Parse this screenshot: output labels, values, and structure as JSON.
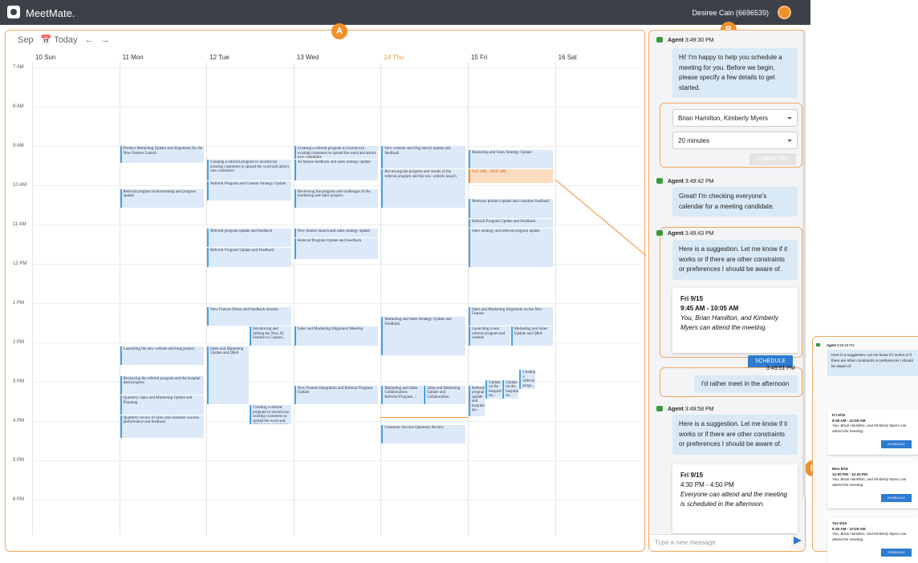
{
  "app": {
    "name": "MeetMate.",
    "user": "Desiree Cain (6696539)"
  },
  "calendar": {
    "month": "Sep",
    "today_label": "Today",
    "days": [
      {
        "label": "10 Sun"
      },
      {
        "label": "11 Mon"
      },
      {
        "label": "12 Tue"
      },
      {
        "label": "13 Wed"
      },
      {
        "label": "14 Thu",
        "today": true
      },
      {
        "label": "15 Fri"
      },
      {
        "label": "16 Sat"
      }
    ],
    "hours": [
      "7 AM",
      "8 AM",
      "9 AM",
      "10 AM",
      "11 AM",
      "12 PM",
      "1 PM",
      "2 PM",
      "3 PM",
      "4 PM",
      "5 PM",
      "6 PM"
    ],
    "events": [
      {
        "day": 1,
        "start": 9.0,
        "end": 9.45,
        "title": "Product Marketing Update and Alignment for the New Feature Launch"
      },
      {
        "day": 1,
        "start": 10.1,
        "end": 10.6,
        "title": "Referral program brainstorming and progress update"
      },
      {
        "day": 1,
        "start": 14.1,
        "end": 14.6,
        "title": "Launching the new website and blog project"
      },
      {
        "day": 1,
        "start": 14.85,
        "end": 15.35,
        "title": "Reviewing the referral program and the hospital deal progress"
      },
      {
        "day": 1,
        "start": 15.35,
        "end": 15.85,
        "title": "Quarterly Sales and Marketing Update and Planning"
      },
      {
        "day": 1,
        "start": 15.85,
        "end": 16.45,
        "title": "Quarterly review of sales and customer success performance and feedback"
      },
      {
        "day": 2,
        "start": 9.35,
        "end": 9.9,
        "title": "Creating a referral program to incentivize existing customers to spread the word and attract new customers"
      },
      {
        "day": 2,
        "start": 9.9,
        "end": 10.4,
        "title": "Referral Program and Content Strategy Update"
      },
      {
        "day": 2,
        "start": 11.1,
        "end": 11.6,
        "title": "Referral program update and feedback"
      },
      {
        "day": 2,
        "start": 11.6,
        "end": 12.1,
        "title": "Referral Program Update and Feedback"
      },
      {
        "day": 2,
        "start": 13.1,
        "end": 13.6,
        "title": "New Feature Demo and Feedback Session"
      },
      {
        "day": 2,
        "start": 13.6,
        "end": 14.1,
        "title": "Introducing and Selling the New AI Feature to Custom...",
        "col": 1,
        "cols": 2
      },
      {
        "day": 2,
        "start": 14.1,
        "end": 15.6,
        "title": "Sales and Marketing Update and Q&A",
        "col": 0,
        "cols": 2
      },
      {
        "day": 2,
        "start": 15.6,
        "end": 16.1,
        "title": "Creating a referral program to incentivize existing customers to spread the word and attract new customers",
        "col": 1,
        "cols": 2
      },
      {
        "day": 3,
        "start": 9.0,
        "end": 9.35,
        "title": "Creating a referral program to incentivize existing customers to spread the word and attract new customers"
      },
      {
        "day": 3,
        "start": 9.35,
        "end": 9.9,
        "title": "AI feature feedback and sales strategy update"
      },
      {
        "day": 3,
        "start": 10.1,
        "end": 10.6,
        "title": "Reviewing the progress and challenges of the marketing and sales projects"
      },
      {
        "day": 3,
        "start": 11.1,
        "end": 11.35,
        "title": "New feature launch and sales strategy update"
      },
      {
        "day": 3,
        "start": 11.35,
        "end": 11.9,
        "title": "Referral Program Update and Feedback"
      },
      {
        "day": 3,
        "start": 13.6,
        "end": 14.1,
        "title": "Sales and Marketing Alignment Meeting"
      },
      {
        "day": 3,
        "start": 15.1,
        "end": 15.6,
        "title": "New Feature Integration and Referral Program Update"
      },
      {
        "day": 4,
        "start": 9.0,
        "end": 9.6,
        "title": "New website and blog launch update and feedback"
      },
      {
        "day": 4,
        "start": 9.6,
        "end": 10.6,
        "title": "Reviewing the progress and results of the referral program and the new website launch"
      },
      {
        "day": 4,
        "start": 13.35,
        "end": 14.35,
        "title": "Marketing and Sales Strategy Update and Feedback"
      },
      {
        "day": 4,
        "start": 15.1,
        "end": 15.6,
        "title": "Marketing and Sales Collaboration: Referral Program ...",
        "col": 0,
        "cols": 2
      },
      {
        "day": 4,
        "start": 15.1,
        "end": 15.6,
        "title": "Sales and Marketing Update and Collaboration",
        "col": 1,
        "cols": 2
      },
      {
        "day": 4,
        "start": 16.1,
        "end": 16.6,
        "title": "Customer Success Quarterly Review"
      },
      {
        "day": 5,
        "start": 9.1,
        "end": 9.6,
        "title": "Marketing and Sales Strategy Update"
      },
      {
        "day": 5,
        "start": 9.6,
        "end": 9.95,
        "title": "9:45 AM - 10:05 AM",
        "orange": true
      },
      {
        "day": 5,
        "start": 10.35,
        "end": 10.85,
        "title": "Medwise product update and customer feedback"
      },
      {
        "day": 5,
        "start": 10.85,
        "end": 11.1,
        "title": "Referral Program Update and Feedback"
      },
      {
        "day": 5,
        "start": 11.1,
        "end": 12.1,
        "title": "Sales strategy and referral program update"
      },
      {
        "day": 5,
        "start": 13.1,
        "end": 13.6,
        "title": "Sales and Marketing Alignment on the New Feature"
      },
      {
        "day": 5,
        "start": 13.6,
        "end": 14.1,
        "title": "Launching a new referral program and website",
        "col": 0,
        "cols": 2
      },
      {
        "day": 5,
        "start": 13.6,
        "end": 14.1,
        "title": "Marketing and Sales Update and Q&A",
        "col": 1,
        "cols": 2
      },
      {
        "day": 5,
        "start": 15.1,
        "end": 15.9,
        "title": "Referral program update and hospital pa...",
        "col": 0,
        "cols": 5
      },
      {
        "day": 5,
        "start": 14.95,
        "end": 15.45,
        "title": "Update on the hospital ne...",
        "col": 1,
        "cols": 5
      },
      {
        "day": 5,
        "start": 14.95,
        "end": 15.45,
        "title": "Update on the hospital ne...",
        "col": 2,
        "cols": 5
      },
      {
        "day": 5,
        "start": 14.7,
        "end": 15.2,
        "title": "Creating a referral progr...",
        "col": 3,
        "cols": 5
      }
    ]
  },
  "chat": {
    "messages": [
      {
        "sender": "Agent",
        "time": "3:49:30 PM",
        "text": "Hi! I'm happy to help you schedule a meeting for you. Before we begin, please specify a few details to get started."
      },
      {
        "sender": "Agent",
        "time": "3:49:42 PM",
        "text": "Great! I'm checking everyone's calendar for a meeting candidate."
      },
      {
        "sender": "Agent",
        "time": "3:49:43 PM",
        "text": "Here is a suggestion. Let me know if it works or if there are other constraints or preferences I should be aware of."
      },
      {
        "sender": "User",
        "time": "3:49:51 PM",
        "text": "I'd rather meet in the afternoon"
      },
      {
        "sender": "Agent",
        "time": "3:49:58 PM",
        "text": "Here is a suggestion. Let me know if it works or if there are other constraints or preferences I should be aware of."
      }
    ],
    "form": {
      "attendees": "Brian Hamilton, Kimberly Myers",
      "duration": "20 minutes",
      "submit_label": "SUBMITTED"
    },
    "suggestion1": {
      "day": "Fri 9/15",
      "time": "9:45 AM - 10:05 AM",
      "note": "You, Brian Hamilton, and Kimberly Myers can attend the meeting.",
      "button": "SCHEDULE"
    },
    "suggestion2": {
      "day": "Fri 9/15",
      "time": "4:30 PM - 4:50 PM",
      "note": "Everyone can attend and the meeting is scheduled in the afternoon."
    },
    "input_placeholder": "Type a new message"
  },
  "side_panel": {
    "header": {
      "sender": "Agent",
      "time": "3:56:29 PM"
    },
    "text": "Here is a suggestion. Let me know if it works or if there are other constraints or preferences I should be aware of.",
    "cards": [
      {
        "day": "Fri 9/15",
        "time": "9:45 AM - 10:05 AM",
        "note": "You, Brian Hamilton, and Kimberly Myers can attend the meeting.",
        "button": "SCHEDULE"
      },
      {
        "day": "Mon 9/18",
        "time": "12:00 PM - 12:20 PM",
        "note": "You, Brian Hamilton, and Kimberly Myers can attend the meeting.",
        "button": "SCHEDULE"
      },
      {
        "day": "Tue 9/19",
        "time": "9:45 AM - 10:05 AM",
        "note": "You, Brian Hamilton, and Kimberly Myers can attend the meeting.",
        "button": "SCHEDULE"
      }
    ]
  },
  "annotations": [
    "A",
    "B",
    "C",
    "D",
    "E",
    "F"
  ],
  "colors": {
    "accent": "#f0902c",
    "event_bg": "#dce9f8",
    "event_border": "#4aa0e6",
    "topbar": "#3d4048",
    "button": "#2e7bd0"
  }
}
